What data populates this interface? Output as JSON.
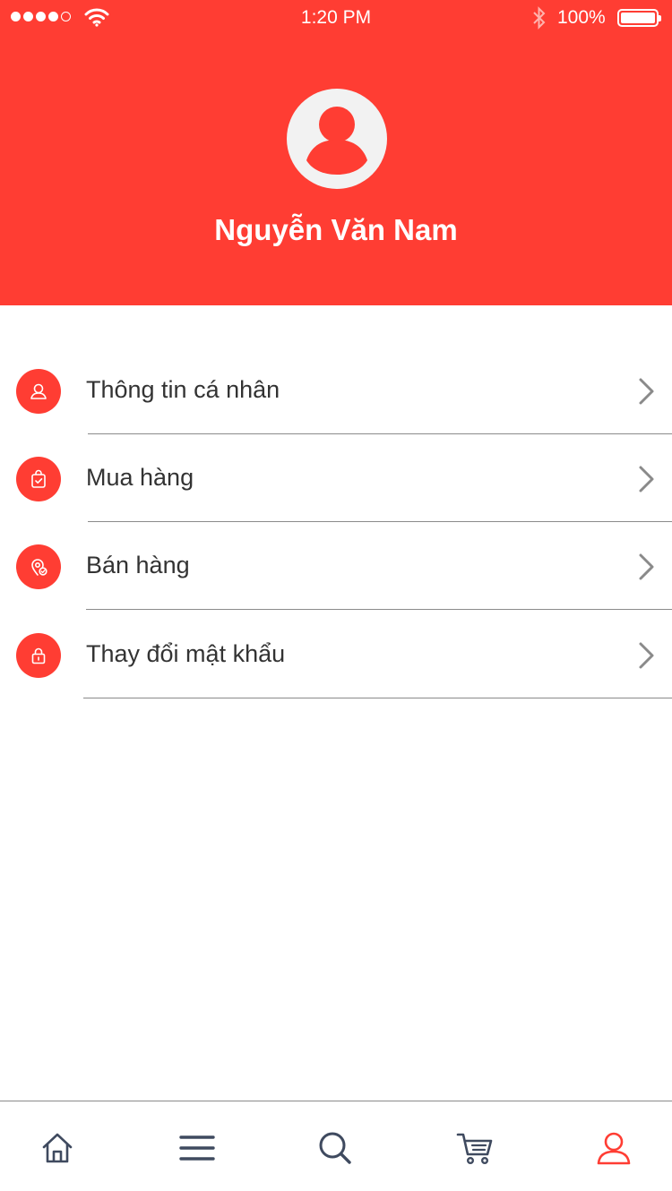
{
  "status_bar": {
    "time": "1:20 PM",
    "battery_text": "100%",
    "signal_icon": "signal-dots-icon",
    "wifi_icon": "wifi-icon",
    "bluetooth_icon": "bluetooth-icon",
    "battery_icon": "battery-icon"
  },
  "profile": {
    "name": "Nguyễn Văn Nam",
    "avatar_icon": "user-avatar-icon"
  },
  "menu": {
    "items": [
      {
        "label": "Thông tin cá nhân",
        "icon": "user-icon"
      },
      {
        "label": "Mua hàng",
        "icon": "shopping-bag-check-icon"
      },
      {
        "label": "Bán hàng",
        "icon": "location-check-icon"
      },
      {
        "label": "Thay đổi mật khẩu",
        "icon": "lock-icon"
      }
    ]
  },
  "bottom_nav": {
    "items": [
      {
        "icon": "home-icon",
        "active": false
      },
      {
        "icon": "menu-icon",
        "active": false
      },
      {
        "icon": "search-icon",
        "active": false
      },
      {
        "icon": "cart-icon",
        "active": false
      },
      {
        "icon": "profile-icon",
        "active": true
      }
    ]
  },
  "colors": {
    "accent": "#FF3D33",
    "text": "#333333",
    "icon_inactive": "#3F4A5F",
    "divider": "#8A8A8A"
  }
}
